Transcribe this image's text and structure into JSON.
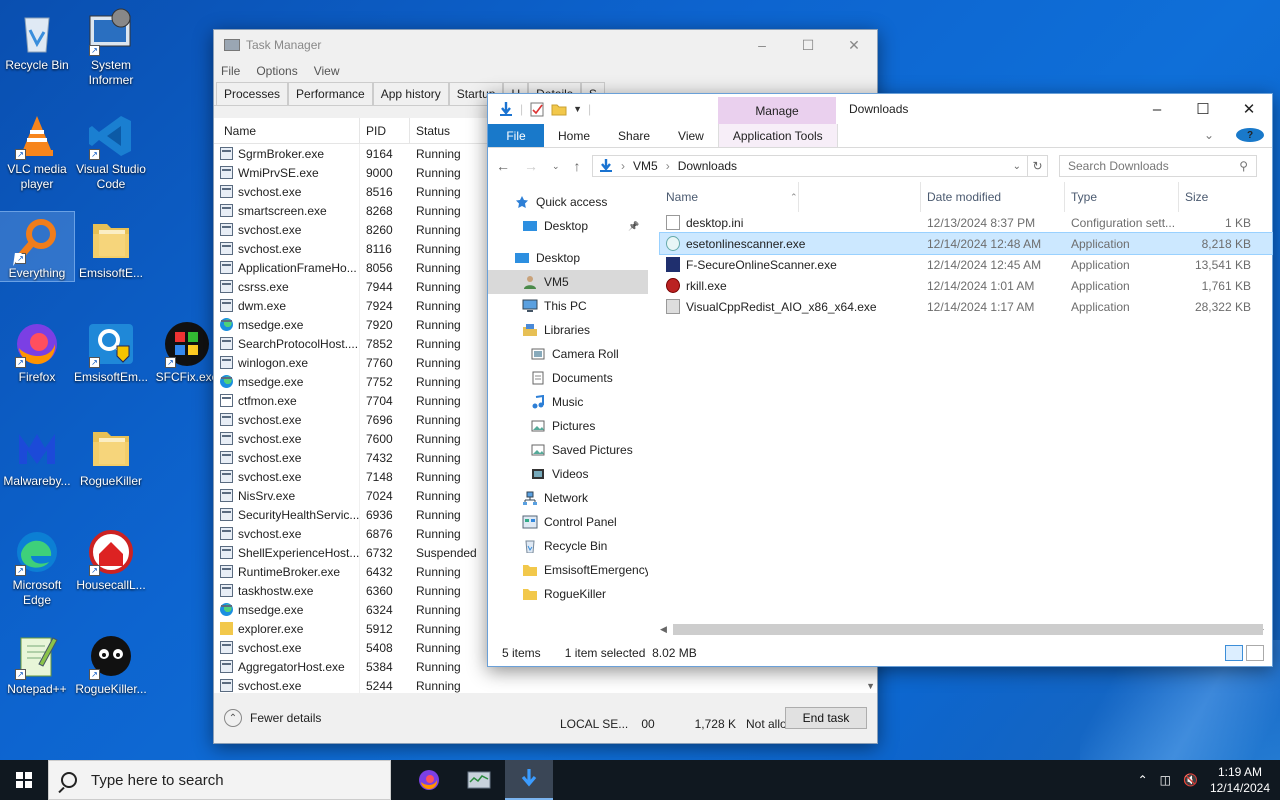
{
  "desktop": {
    "icons": [
      {
        "label": "Recycle Bin",
        "icon": "recycle-bin-icon"
      },
      {
        "label": "System Informer",
        "icon": "system-informer-icon"
      },
      {
        "label": "VLC media player",
        "icon": "vlc-icon"
      },
      {
        "label": "Visual Studio Code",
        "icon": "vscode-icon"
      },
      {
        "label": "Everything",
        "icon": "everything-icon"
      },
      {
        "label": "EmsisoftE...",
        "icon": "folder-icon"
      },
      {
        "label": "Firefox",
        "icon": "firefox-icon"
      },
      {
        "label": "EmsisoftEm...",
        "icon": "emsisoft-shield-icon"
      },
      {
        "label": "SFCFix.exe",
        "icon": "sfcfix-icon"
      },
      {
        "label": "Malwareby...",
        "icon": "malwarebytes-icon"
      },
      {
        "label": "RogueKiller",
        "icon": "folder-icon"
      },
      {
        "label": "Microsoft Edge",
        "icon": "edge-icon"
      },
      {
        "label": "HousecallL...",
        "icon": "housecall-icon"
      },
      {
        "label": "Notepad++",
        "icon": "notepadpp-icon"
      },
      {
        "label": "RogueKiller...",
        "icon": "roguekiller-icon"
      }
    ]
  },
  "task_manager": {
    "title": "Task Manager",
    "menu": [
      "File",
      "Options",
      "View"
    ],
    "tabs": [
      "Processes",
      "Performance",
      "App history",
      "Startup",
      "U",
      "Details",
      "S"
    ],
    "columns": {
      "name": "Name",
      "pid": "PID",
      "status": "Status"
    },
    "processes": [
      {
        "name": "SgrmBroker.exe",
        "pid": "9164",
        "status": "Running",
        "icon": "app"
      },
      {
        "name": "WmiPrvSE.exe",
        "pid": "9000",
        "status": "Running",
        "icon": "app"
      },
      {
        "name": "svchost.exe",
        "pid": "8516",
        "status": "Running",
        "icon": "app"
      },
      {
        "name": "smartscreen.exe",
        "pid": "8268",
        "status": "Running",
        "icon": "app"
      },
      {
        "name": "svchost.exe",
        "pid": "8260",
        "status": "Running",
        "icon": "app"
      },
      {
        "name": "svchost.exe",
        "pid": "8116",
        "status": "Running",
        "icon": "app"
      },
      {
        "name": "ApplicationFrameHo...",
        "pid": "8056",
        "status": "Running",
        "icon": "app"
      },
      {
        "name": "csrss.exe",
        "pid": "7944",
        "status": "Running",
        "icon": "app"
      },
      {
        "name": "dwm.exe",
        "pid": "7924",
        "status": "Running",
        "icon": "app"
      },
      {
        "name": "msedge.exe",
        "pid": "7920",
        "status": "Running",
        "icon": "edge"
      },
      {
        "name": "SearchProtocolHost....",
        "pid": "7852",
        "status": "Running",
        "icon": "app"
      },
      {
        "name": "winlogon.exe",
        "pid": "7760",
        "status": "Running",
        "icon": "app"
      },
      {
        "name": "msedge.exe",
        "pid": "7752",
        "status": "Running",
        "icon": "edge"
      },
      {
        "name": "ctfmon.exe",
        "pid": "7704",
        "status": "Running",
        "icon": "pen"
      },
      {
        "name": "svchost.exe",
        "pid": "7696",
        "status": "Running",
        "icon": "app"
      },
      {
        "name": "svchost.exe",
        "pid": "7600",
        "status": "Running",
        "icon": "app"
      },
      {
        "name": "svchost.exe",
        "pid": "7432",
        "status": "Running",
        "icon": "app"
      },
      {
        "name": "svchost.exe",
        "pid": "7148",
        "status": "Running",
        "icon": "app"
      },
      {
        "name": "NisSrv.exe",
        "pid": "7024",
        "status": "Running",
        "icon": "app"
      },
      {
        "name": "SecurityHealthServic...",
        "pid": "6936",
        "status": "Running",
        "icon": "app"
      },
      {
        "name": "svchost.exe",
        "pid": "6876",
        "status": "Running",
        "icon": "app"
      },
      {
        "name": "ShellExperienceHost....",
        "pid": "6732",
        "status": "Suspended",
        "icon": "app"
      },
      {
        "name": "RuntimeBroker.exe",
        "pid": "6432",
        "status": "Running",
        "icon": "app"
      },
      {
        "name": "taskhostw.exe",
        "pid": "6360",
        "status": "Running",
        "icon": "app"
      },
      {
        "name": "msedge.exe",
        "pid": "6324",
        "status": "Running",
        "icon": "edge"
      },
      {
        "name": "explorer.exe",
        "pid": "5912",
        "status": "Running",
        "icon": "folder"
      },
      {
        "name": "svchost.exe",
        "pid": "5408",
        "status": "Running",
        "icon": "app"
      },
      {
        "name": "AggregatorHost.exe",
        "pid": "5384",
        "status": "Running",
        "icon": "app"
      },
      {
        "name": "svchost.exe",
        "pid": "5244",
        "status": "Running",
        "icon": "app"
      }
    ],
    "last_row_extra": {
      "user": "LOCAL SE...",
      "cpu": "00",
      "memory": "1,728 K",
      "uac": "Not allowed"
    },
    "fewer_details": "Fewer details",
    "end_task": "End task"
  },
  "explorer": {
    "manage_tab": "Manage",
    "title": "Downloads",
    "ribbon": {
      "file": "File",
      "home": "Home",
      "share": "Share",
      "view": "View",
      "app_tools": "Application Tools"
    },
    "address": {
      "root": "VM5",
      "folder": "Downloads"
    },
    "search_placeholder": "Search Downloads",
    "nav": [
      {
        "label": "Quick access",
        "icon": "star-icon",
        "indent": 0
      },
      {
        "label": "Desktop",
        "icon": "desktop-icon",
        "indent": 1,
        "pinned": true
      },
      {
        "label": "Desktop",
        "icon": "desktop-icon",
        "indent": 0
      },
      {
        "label": "VM5",
        "icon": "user-icon",
        "indent": 1,
        "selected": true
      },
      {
        "label": "This PC",
        "icon": "pc-icon",
        "indent": 1
      },
      {
        "label": "Libraries",
        "icon": "library-icon",
        "indent": 1
      },
      {
        "label": "Camera Roll",
        "icon": "camera-roll-icon",
        "indent": 2
      },
      {
        "label": "Documents",
        "icon": "documents-icon",
        "indent": 2
      },
      {
        "label": "Music",
        "icon": "music-icon",
        "indent": 2
      },
      {
        "label": "Pictures",
        "icon": "pictures-icon",
        "indent": 2
      },
      {
        "label": "Saved Pictures",
        "icon": "pictures-icon",
        "indent": 2
      },
      {
        "label": "Videos",
        "icon": "videos-icon",
        "indent": 2
      },
      {
        "label": "Network",
        "icon": "network-icon",
        "indent": 1
      },
      {
        "label": "Control Panel",
        "icon": "control-panel-icon",
        "indent": 1
      },
      {
        "label": "Recycle Bin",
        "icon": "recycle-bin-icon",
        "indent": 1
      },
      {
        "label": "EmsisoftEmergency",
        "icon": "folder-icon",
        "indent": 1
      },
      {
        "label": "RogueKiller",
        "icon": "folder-icon",
        "indent": 1
      }
    ],
    "columns": {
      "name": "Name",
      "date": "Date modified",
      "type": "Type",
      "size": "Size"
    },
    "files": [
      {
        "name": "desktop.ini",
        "date": "12/13/2024 8:37 PM",
        "type": "Configuration sett...",
        "size": "1 KB",
        "icon": "ini",
        "dim": true
      },
      {
        "name": "esetonlinescanner.exe",
        "date": "12/14/2024 12:48 AM",
        "type": "Application",
        "size": "8,218 KB",
        "icon": "eset",
        "selected": true
      },
      {
        "name": "F-SecureOnlineScanner.exe",
        "date": "12/14/2024 12:45 AM",
        "type": "Application",
        "size": "13,541 KB",
        "icon": "fsec"
      },
      {
        "name": "rkill.exe",
        "date": "12/14/2024 1:01 AM",
        "type": "Application",
        "size": "1,761 KB",
        "icon": "rk"
      },
      {
        "name": "VisualCppRedist_AIO_x86_x64.exe",
        "date": "12/14/2024 1:17 AM",
        "type": "Application",
        "size": "28,322 KB",
        "icon": "vc"
      }
    ],
    "status": {
      "items": "5 items",
      "selected": "1 item selected  8.02 MB"
    }
  },
  "taskbar": {
    "search_placeholder": "Type here to search",
    "time": "1:19 AM",
    "date": "12/14/2024"
  }
}
